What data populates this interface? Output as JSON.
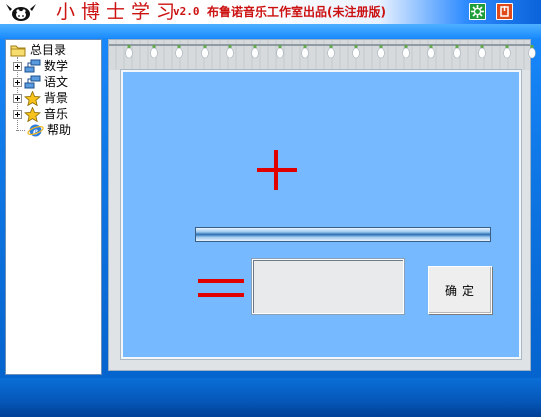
{
  "window": {
    "title": "小博士学习",
    "version": "v2.0",
    "publisher": "布鲁诺音乐工作室出品(未注册版)",
    "logo_icon": "bull-mascot-icon",
    "buttons": [
      {
        "name": "settings-button",
        "icon": "gear-icon",
        "color": "#1e9e3a"
      },
      {
        "name": "close-button",
        "icon": "power-icon",
        "color": "#e04a1a"
      }
    ]
  },
  "sidebar": {
    "root": {
      "label": "总目录",
      "icon": "folder-icon"
    },
    "items": [
      {
        "label": "数学",
        "icon": "network-icon",
        "expandable": true
      },
      {
        "label": "语文",
        "icon": "network-icon",
        "expandable": true
      },
      {
        "label": "背景",
        "icon": "star-icon",
        "expandable": true
      },
      {
        "label": "音乐",
        "icon": "star-icon",
        "expandable": true
      },
      {
        "label": "帮助",
        "icon": "internet-explorer-icon",
        "expandable": false
      }
    ]
  },
  "exercise": {
    "operator": "+",
    "equals": "=",
    "answer_value": "",
    "confirm_label": "确定",
    "accent_color": "#e00000",
    "board_color": "#76b9ff"
  }
}
